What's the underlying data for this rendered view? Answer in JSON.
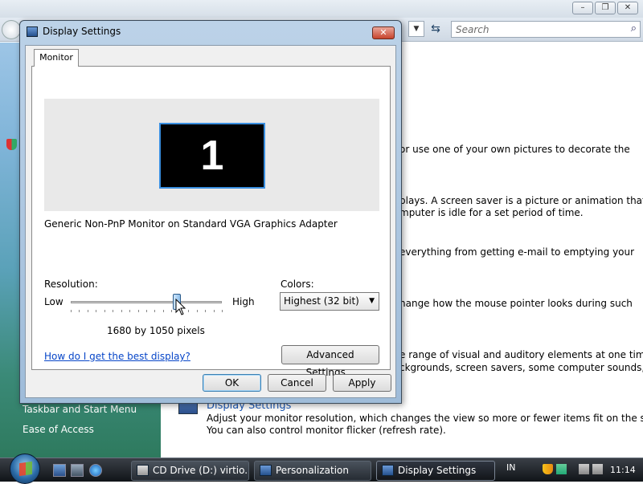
{
  "background_window": {
    "search_placeholder": "Search",
    "left_links": [
      "Taskbar and Start Menu",
      "Ease of Access"
    ],
    "text_lines": [
      "or use one of your own pictures to decorate the",
      "plays. A screen saver is a picture or animation that",
      "mputer is idle for a set period of time.",
      "everything from getting e-mail to emptying your",
      "hange how the mouse pointer looks during such",
      "e range of visual and auditory elements at one time",
      "ckgrounds, screen savers, some computer sounds, and"
    ],
    "display_settings_heading": "Display Settings",
    "display_settings_desc": [
      "Adjust your monitor resolution, which changes the view so more or fewer items fit on the screen.",
      "You can also control monitor flicker (refresh rate)."
    ]
  },
  "dialog": {
    "title": "Display Settings",
    "close_label": "✕",
    "tab": "Monitor",
    "monitor_number": "1",
    "monitor_description": "Generic Non-PnP Monitor on Standard VGA Graphics Adapter",
    "resolution": {
      "label": "Resolution:",
      "low": "Low",
      "high": "High",
      "value": "1680 by 1050 pixels",
      "slider_fraction": 0.7
    },
    "colors": {
      "label": "Colors:",
      "selected": "Highest (32 bit)"
    },
    "help_link": "How do I get the best display?",
    "advanced_button": "Advanced Settings...",
    "ok_button": "OK",
    "cancel_button": "Cancel",
    "apply_button": "Apply"
  },
  "taskbar": {
    "items": [
      {
        "label": "CD Drive (D:) virtio...",
        "active": false
      },
      {
        "label": "Personalization",
        "active": false
      },
      {
        "label": "Display Settings",
        "active": true
      }
    ],
    "language": "IN",
    "clock": "11:14"
  }
}
